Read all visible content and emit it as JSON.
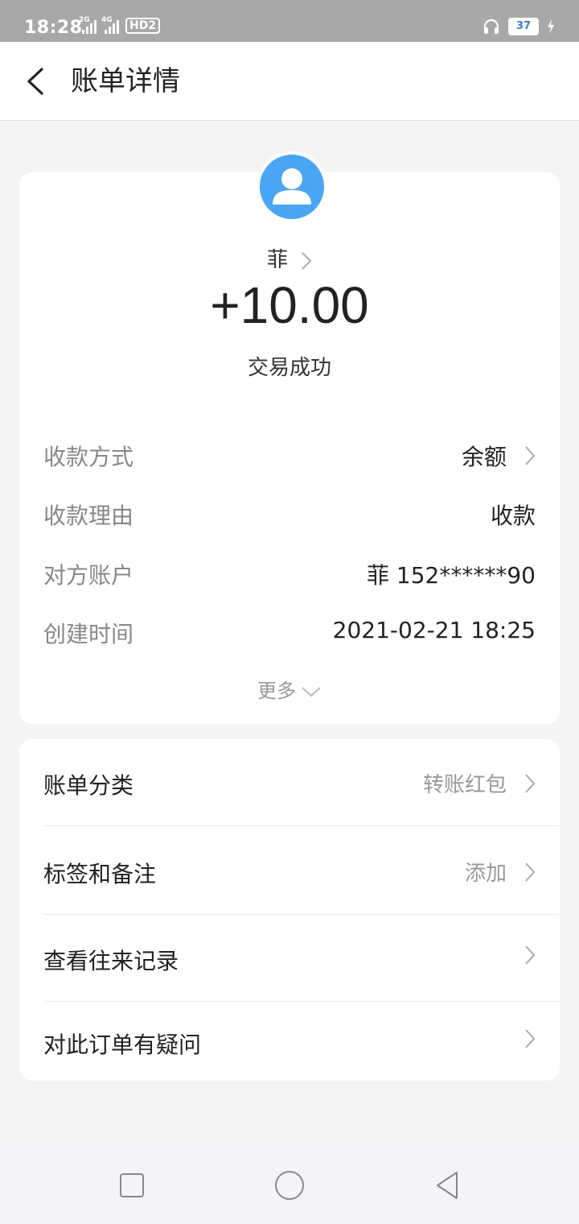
{
  "status_bar": {
    "time": "18:28",
    "net1": "2G",
    "net2": "4G",
    "hd": "HD2",
    "battery": "37"
  },
  "header": {
    "title": "账单详情"
  },
  "transaction": {
    "name": "菲",
    "amount": "+10.00",
    "status": "交易成功"
  },
  "details": [
    {
      "label": "收款方式",
      "value": "余额",
      "has_arrow": true
    },
    {
      "label": "收款理由",
      "value": "收款",
      "has_arrow": false
    },
    {
      "label": "对方账户",
      "value": "菲 152******90",
      "has_arrow": false
    },
    {
      "label": "创建时间",
      "value": "2021-02-21 18:25",
      "has_arrow": false
    }
  ],
  "more_label": "更多",
  "actions": [
    {
      "label": "账单分类",
      "value": "转账红包"
    },
    {
      "label": "标签和备注",
      "value": "添加"
    },
    {
      "label": "查看往来记录",
      "value": ""
    },
    {
      "label": "对此订单有疑问",
      "value": ""
    }
  ],
  "colors": {
    "accent_blue": "#4aa5f5",
    "background": "#f4f4f5",
    "status_bar": "#a8a8a8"
  },
  "icons": {
    "back": "chevron-left-icon",
    "avatar": "user-icon",
    "arrow": "chevron-right-icon",
    "more": "chevron-down-icon",
    "headset": "headset-icon",
    "battery": "battery-icon",
    "nav_recent": "square-icon",
    "nav_home": "circle-icon",
    "nav_back": "triangle-back-icon"
  }
}
